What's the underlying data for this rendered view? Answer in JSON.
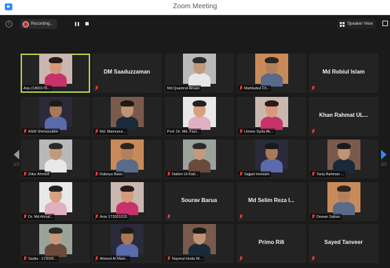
{
  "window": {
    "title": "Zoom Meeting"
  },
  "toolbar": {
    "recording_label": "Recording...",
    "speaker_view_label": "Speaker View"
  },
  "pager": {
    "prev_page": "1/2",
    "next_page": "2/2"
  },
  "participants": [
    {
      "name": "Arju (1800178...",
      "photo": true,
      "active": true,
      "muted": false
    },
    {
      "name": "DM Saaduzzaman",
      "photo": false,
      "muted": true
    },
    {
      "name": "Md Quamrul Ahsan",
      "photo": true,
      "muted": false
    },
    {
      "name": "Mahbubul Ch...",
      "photo": true,
      "muted": true
    },
    {
      "name": "Md Robiul Islam",
      "photo": false,
      "muted": true
    },
    {
      "name": "ASM Shihavuddin",
      "photo": true,
      "muted": true
    },
    {
      "name": "Md. Mamunur...",
      "photo": true,
      "muted": true
    },
    {
      "name": "Prof. Dr. Md. Fazl...",
      "photo": true,
      "muted": false
    },
    {
      "name": "Umme Syda Ak...",
      "photo": true,
      "muted": true
    },
    {
      "name": "Khan Rahmat UL...",
      "photo": false,
      "muted": true
    },
    {
      "name": "Zillur Ahmed",
      "photo": true,
      "muted": true
    },
    {
      "name": "Rabeya Basu",
      "photo": true,
      "muted": true
    },
    {
      "name": "Nahim Ul Kab...",
      "photo": true,
      "muted": true
    },
    {
      "name": "Sajjad Hossain",
      "photo": true,
      "muted": true
    },
    {
      "name": "Tariq Rahman ...",
      "photo": true,
      "muted": true
    },
    {
      "name": "Dr. Md Ahnaf...",
      "photo": true,
      "muted": true
    },
    {
      "name": "Anis 172001015",
      "photo": true,
      "muted": true
    },
    {
      "name": "Sourav Barua",
      "photo": false,
      "muted": true
    },
    {
      "name": "Md Selim Reza I...",
      "photo": false,
      "muted": true
    },
    {
      "name": "Dewan Sahan",
      "photo": true,
      "muted": true
    },
    {
      "name": "Sadia - 172026...",
      "photo": true,
      "muted": true
    },
    {
      "name": "Ahmed Al Mam...",
      "photo": true,
      "muted": true
    },
    {
      "name": "Naymul Huda W...",
      "photo": true,
      "muted": true
    },
    {
      "name": "Primo Ri6",
      "photo": false,
      "muted": true
    },
    {
      "name": "Sayed Tanveer",
      "photo": false,
      "muted": true
    }
  ],
  "colors": {
    "active_speaker_border": "#b8d64a",
    "muted_mic": "#e03a3a",
    "accent": "#2d8cff",
    "recording": "#e02828"
  }
}
